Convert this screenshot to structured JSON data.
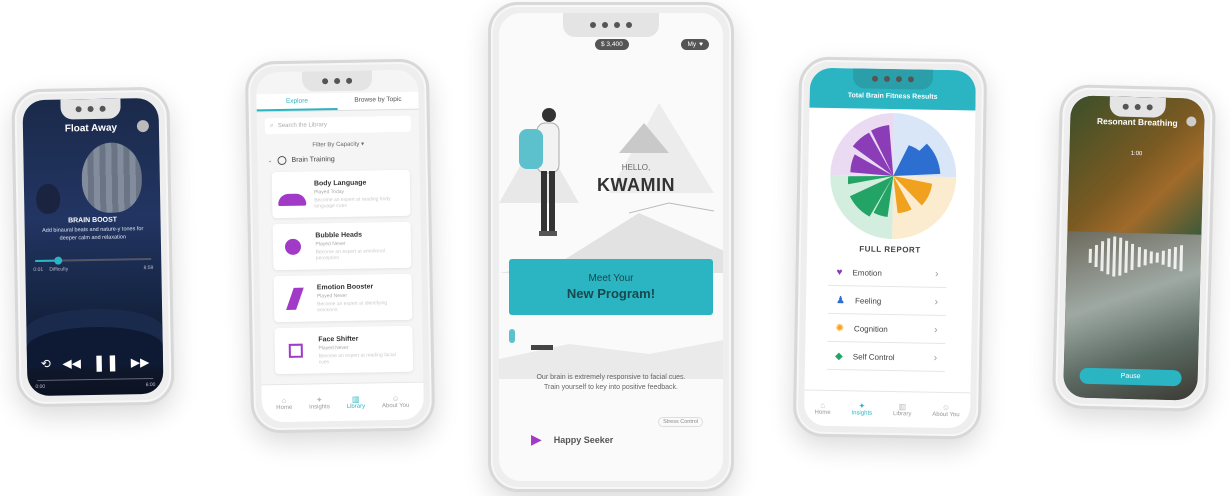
{
  "phone1": {
    "title": "Float Away",
    "headline": "BRAIN BOOST",
    "subtitle": "Add binaural beats and nature-y tones for deeper calm and relaxation",
    "time_start": "0:01",
    "time_mid": "Difficulty",
    "time_end": "8:59",
    "bottom_start": "0:00",
    "bottom_end": "6:00",
    "progress": 0.2
  },
  "phone2": {
    "tabs": [
      "Explore",
      "Browse by Topic"
    ],
    "search_placeholder": "Search the Library",
    "filter_label": "Filter By Capacity ▾",
    "section_title": "Brain Training",
    "items": [
      {
        "title": "Body Language",
        "meta": "Played Today",
        "desc": "Become an expert at reading body language cues",
        "color": "#a23ac8"
      },
      {
        "title": "Bubble Heads",
        "meta": "Played Never",
        "desc": "Become an expert at emotional perception",
        "color": "#a23ac8"
      },
      {
        "title": "Emotion Booster",
        "meta": "Played Never",
        "desc": "Become an expert at identifying emotions",
        "color": "#a23ac8"
      },
      {
        "title": "Face Shifter",
        "meta": "Played Never",
        "desc": "Become an expert at reading facial cues",
        "color": "#a23ac8"
      }
    ],
    "nav": [
      "Home",
      "Insights",
      "Library",
      "About You"
    ]
  },
  "phone3": {
    "balance": "$ 3,400",
    "badge": "My",
    "greeting": "HELLO,",
    "name": "KWAMIN",
    "cta_line1": "Meet Your",
    "cta_line2": "New Program!",
    "body": "Our brain is extremely responsive to facial cues. Train yourself to key into positive feedback.",
    "tag": "Stress Control",
    "program": "Happy Seeker",
    "accent": "#2bb5c3"
  },
  "phone4": {
    "header": "Total Brain Fitness Results",
    "report_title": "FULL REPORT",
    "rows": [
      {
        "label": "Emotion",
        "color": "#8b3db8"
      },
      {
        "label": "Feeling",
        "color": "#2d6fd1"
      },
      {
        "label": "Cognition",
        "color": "#f0a21e"
      },
      {
        "label": "Self Control",
        "color": "#23a466"
      }
    ],
    "nav": [
      "Home",
      "Insights",
      "Library",
      "About You"
    ],
    "accent": "#2bb5c3"
  },
  "phone5": {
    "title": "Resonant Breathing",
    "timer": "1:00",
    "button": "Pause",
    "accent": "#2bb5c3"
  }
}
